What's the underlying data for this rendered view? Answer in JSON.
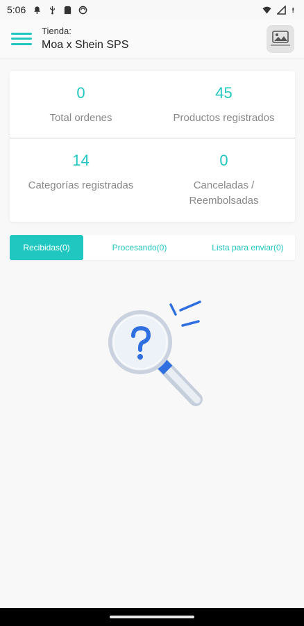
{
  "status_bar": {
    "time": "5:06",
    "icons_left": [
      "notification-bell-icon",
      "usb-icon",
      "sd-card-icon",
      "sync-icon"
    ],
    "icons_right": [
      "wifi-icon",
      "signal-icon",
      "battery-alert-icon"
    ]
  },
  "header": {
    "store_caption": "Tienda:",
    "store_name": "Moa x Shein SPS",
    "accent_color": "#1fc7c0"
  },
  "stats": {
    "total_orders": {
      "value": "0",
      "label": "Total ordenes"
    },
    "registered_products": {
      "value": "45",
      "label": "Productos registrados"
    },
    "registered_categories": {
      "value": "14",
      "label": "Categorías registradas"
    },
    "cancelled_refunded": {
      "value": "0",
      "label_line1": "Canceladas /",
      "label_line2": "Reembolsadas"
    }
  },
  "tabs": [
    {
      "label": "Recibidas(0)",
      "active": true
    },
    {
      "label": "Procesando(0)",
      "active": false
    },
    {
      "label": "Lista para enviar(0)",
      "active": false
    }
  ],
  "empty_state": {
    "icon": "magnifier-question-icon"
  }
}
